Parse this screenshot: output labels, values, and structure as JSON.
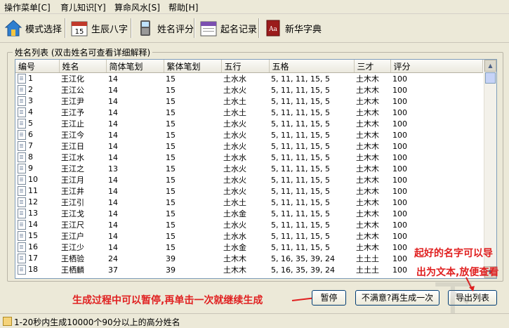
{
  "menu": [
    "操作菜单[C]",
    "育儿知识[Y]",
    "算命风水[S]",
    "帮助[H]"
  ],
  "toolbar": [
    {
      "label": "模式选择",
      "icon": "home-icon"
    },
    {
      "label": "生辰八字",
      "icon": "calendar-icon"
    },
    {
      "label": "姓名评分",
      "icon": "phone-icon"
    },
    {
      "label": "起名记录",
      "icon": "record-calendar-icon"
    },
    {
      "label": "新华字典",
      "icon": "dictionary-icon"
    }
  ],
  "group_title": "姓名列表 (双击姓名可查看详细解释)",
  "columns": [
    "编号",
    "姓名",
    "简体笔划",
    "繁体笔划",
    "五行",
    "五格",
    "三才",
    "评分"
  ],
  "rows": [
    [
      "1",
      "王江化",
      "14",
      "15",
      "土水水",
      "5, 11, 11, 15, 5",
      "土木木",
      "100"
    ],
    [
      "2",
      "王江公",
      "14",
      "15",
      "土水火",
      "5, 11, 11, 15, 5",
      "土木木",
      "100"
    ],
    [
      "3",
      "王江尹",
      "14",
      "15",
      "土水土",
      "5, 11, 11, 15, 5",
      "土木木",
      "100"
    ],
    [
      "4",
      "王江予",
      "14",
      "15",
      "土水土",
      "5, 11, 11, 15, 5",
      "土木木",
      "100"
    ],
    [
      "5",
      "王江止",
      "14",
      "15",
      "土水火",
      "5, 11, 11, 15, 5",
      "土木木",
      "100"
    ],
    [
      "6",
      "王江今",
      "14",
      "15",
      "土水火",
      "5, 11, 11, 15, 5",
      "土木木",
      "100"
    ],
    [
      "7",
      "王江日",
      "14",
      "15",
      "土水火",
      "5, 11, 11, 15, 5",
      "土木木",
      "100"
    ],
    [
      "8",
      "王江水",
      "14",
      "15",
      "土水水",
      "5, 11, 11, 15, 5",
      "土木木",
      "100"
    ],
    [
      "9",
      "王江之",
      "13",
      "15",
      "土水火",
      "5, 11, 11, 15, 5",
      "土木木",
      "100"
    ],
    [
      "10",
      "王江月",
      "14",
      "15",
      "土水火",
      "5, 11, 11, 15, 5",
      "土木木",
      "100"
    ],
    [
      "11",
      "王江井",
      "14",
      "15",
      "土水火",
      "5, 11, 11, 15, 5",
      "土木木",
      "100"
    ],
    [
      "12",
      "王江引",
      "14",
      "15",
      "土水土",
      "5, 11, 11, 15, 5",
      "土木木",
      "100"
    ],
    [
      "13",
      "王江戈",
      "14",
      "15",
      "土水金",
      "5, 11, 11, 15, 5",
      "土木木",
      "100"
    ],
    [
      "14",
      "王江尺",
      "14",
      "15",
      "土水火",
      "5, 11, 11, 15, 5",
      "土木木",
      "100"
    ],
    [
      "15",
      "王江户",
      "14",
      "15",
      "土水水",
      "5, 11, 11, 15, 5",
      "土木木",
      "100"
    ],
    [
      "16",
      "王江少",
      "14",
      "15",
      "土水金",
      "5, 11, 11, 15, 5",
      "土木木",
      "100"
    ],
    [
      "17",
      "王栖验",
      "24",
      "39",
      "土木木",
      "5, 16, 35, 39, 24",
      "土土土",
      "100"
    ],
    [
      "18",
      "王栖麟",
      "37",
      "39",
      "土木木",
      "5, 16, 35, 39, 24",
      "土土土",
      "100"
    ]
  ],
  "buttons": {
    "pause": "暂停",
    "regenerate": "不满意?再生成一次",
    "export": "导出列表"
  },
  "annotations": {
    "pause_tip": "生成过程中可以暂停,再单击一次就继续生成",
    "export_tip_line1": "起好的名字可以导",
    "export_tip_line2": "出为文本,放便查看"
  },
  "status": "1-20秒内生成10000个90分以上的高分姓名",
  "colors": {
    "annotation": "#e02020",
    "window_bg": "#ece9d8",
    "list_border": "#7f9db9"
  }
}
